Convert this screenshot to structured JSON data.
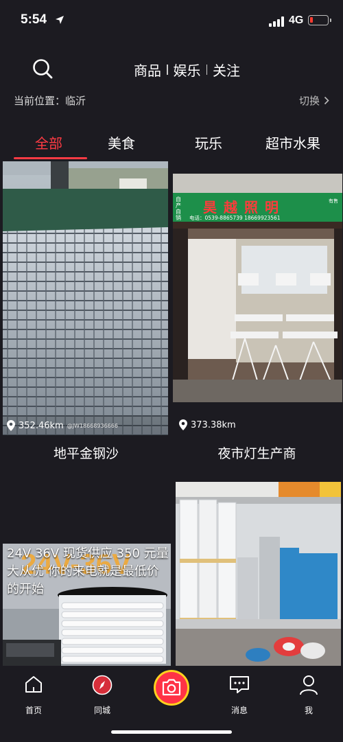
{
  "status_bar": {
    "time": "5:54",
    "network": "4G"
  },
  "header": {
    "tabs": [
      {
        "label": "商品"
      },
      {
        "label": "娱乐"
      },
      {
        "label": "关注"
      }
    ]
  },
  "location": {
    "label": "当前位置：临沂",
    "switch_label": "切换"
  },
  "categories": [
    {
      "label": "全部",
      "active": true
    },
    {
      "label": "美食"
    },
    {
      "label": "玩乐"
    },
    {
      "label": "超市水果"
    }
  ],
  "feed": [
    {
      "title": "地平金钢沙",
      "distance": "352.46km",
      "watermark": "@JW18668936666"
    },
    {
      "title": "夜市灯生产商",
      "distance": "373.38km",
      "shop_sign": "昊越照明",
      "sign_left": "自产自销",
      "sign_right": "有售",
      "phone": "电话：0539-8865739  18669923561"
    },
    {
      "caption": "24V 36V 现货供应 350 元量大从优 你的来电就是最低价的开始",
      "overlay": "24V-36V"
    },
    {
      "caption": ""
    }
  ],
  "tabbar": {
    "items": [
      {
        "label": "首页"
      },
      {
        "label": "同城"
      },
      {
        "label": "消息"
      },
      {
        "label": "我"
      }
    ]
  },
  "colors": {
    "accent": "#ff3b44",
    "background": "#1c1b21"
  }
}
